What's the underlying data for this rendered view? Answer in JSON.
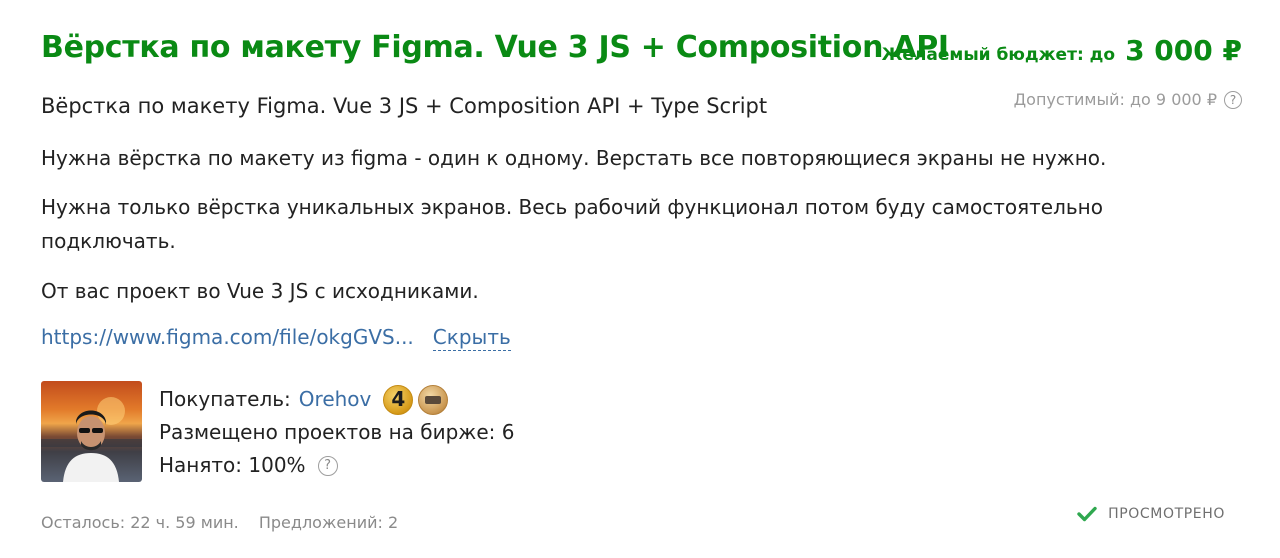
{
  "title": "Вёрстка по макету Figma. Vue 3 JS + Composition API",
  "budget": {
    "label": "Желаемый бюджет: до",
    "value": "3 000 ₽",
    "allowed": "Допустимый: до 9 000 ₽"
  },
  "subtitle": "Вёрстка по макету Figma. Vue 3 JS + Composition API + Type Script",
  "description": [
    "Нужна вёрстка по макету из figma - один к одному. Верстать все повторяющиеся экраны не нужно.",
    "Нужна только вёрстка уникальных экранов. Весь рабочий функционал потом буду самостоятельно подключать.",
    "От вас проект во Vue 3 JS с исходниками."
  ],
  "link": {
    "url_text": "https://www.figma.com/file/okgGVS...",
    "hide_label": "Скрыть"
  },
  "buyer": {
    "label": "Покупатель:",
    "name": "Orehov",
    "level": "4",
    "projects": "Размещено проектов на бирже: 6",
    "hired": "Нанято: 100%"
  },
  "footer": {
    "time_left": "Осталось: 22 ч. 59 мин.",
    "offers": "Предложений: 2",
    "viewed": "ПРОСМОТРЕНО"
  },
  "icons": {
    "help": "question-circle-icon",
    "viewed": "check-icon",
    "medal": "medal-icon"
  },
  "colors": {
    "accent": "#0a8a14",
    "link": "#3b6ea5",
    "muted": "#8a8a8a",
    "check": "#2fa84f"
  }
}
